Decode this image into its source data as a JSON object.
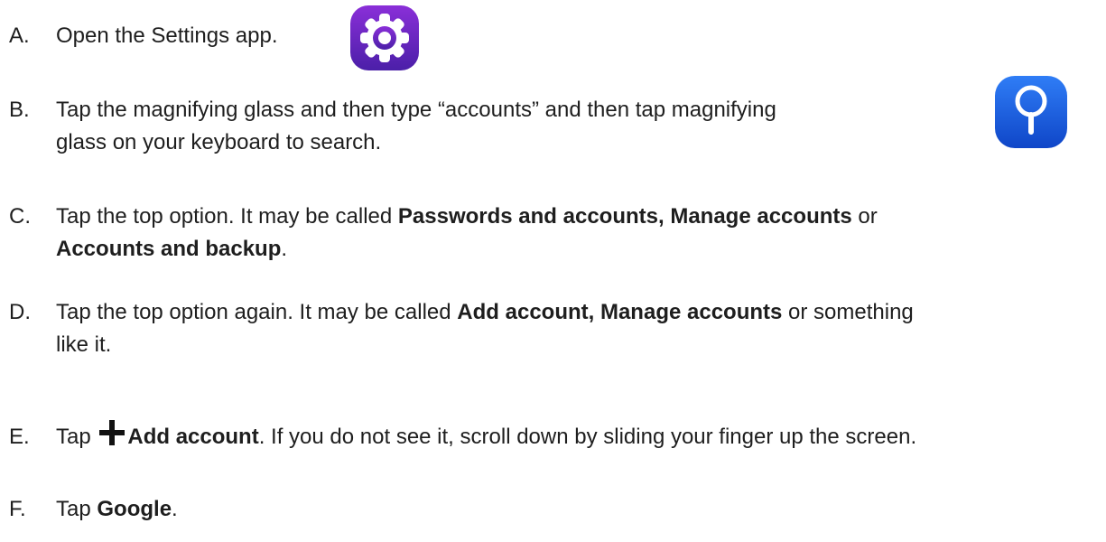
{
  "steps": {
    "a": {
      "letter": "A.",
      "text": "Open the Settings app."
    },
    "b": {
      "letter": "B.",
      "line1": "Tap the magnifying glass and then type “accounts” and then tap magnifying",
      "line2": "glass on your keyboard to search."
    },
    "c": {
      "letter": "C.",
      "pre": "Tap the top option. It may be called ",
      "bold1": "Passwords and accounts, Manage accounts",
      "mid": " or",
      "bold2": "Accounts and backup",
      "end": "."
    },
    "d": {
      "letter": "D.",
      "pre": "Tap the top option again. It may be called ",
      "bold1": "Add account, Manage accounts",
      "post": " or something",
      "line2": "like it."
    },
    "e": {
      "letter": "E.",
      "pre": "Tap ",
      "bold": "Add account",
      "post": ". If you do not see it, scroll down by sliding your finger up the screen."
    },
    "f": {
      "letter": "F.",
      "pre": "Tap ",
      "bold": "Google",
      "end": "."
    }
  },
  "icons": {
    "settings": "gear-icon",
    "search": "magnifying-glass-icon",
    "plus": "plus-icon"
  },
  "colors": {
    "settings_bg_top": "#8a2fd8",
    "settings_bg_bottom": "#4b1fa8",
    "search_bg_top": "#2f7df6",
    "search_bg_bottom": "#0f46c8"
  }
}
